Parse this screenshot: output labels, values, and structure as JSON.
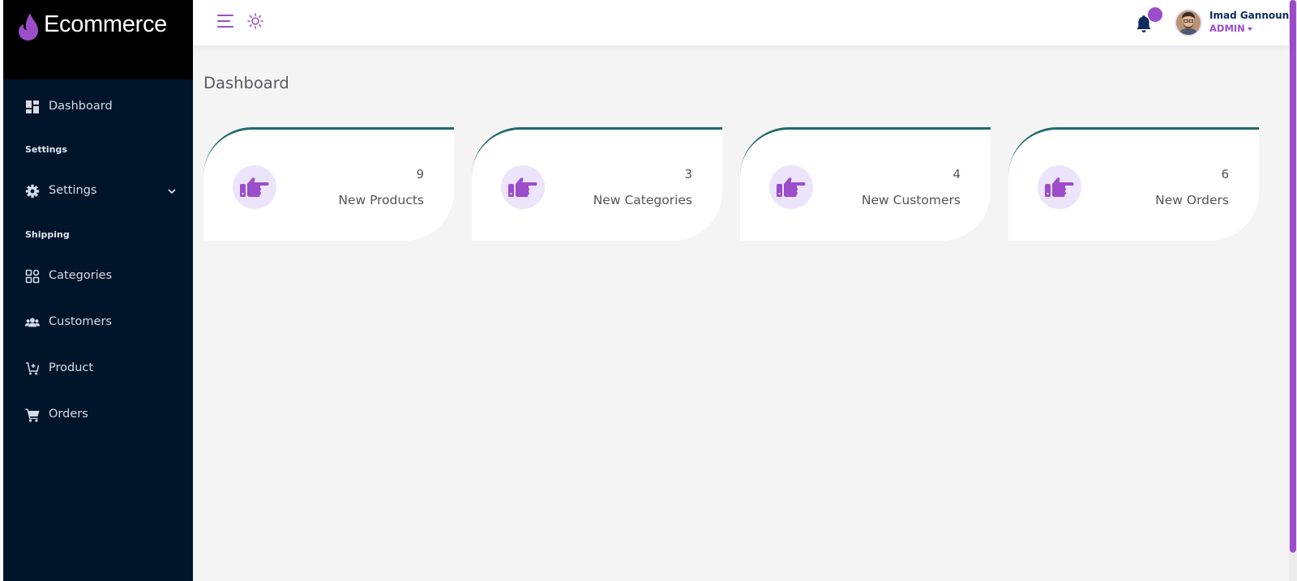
{
  "brand": {
    "name": "Ecommerce",
    "accent": "#9b4dca"
  },
  "sidebar": {
    "items": [
      {
        "label": "Dashboard",
        "icon": "dashboard-icon"
      },
      {
        "label": "Settings",
        "icon": "gear-icon"
      },
      {
        "label": "Categories",
        "icon": "grid-icon"
      },
      {
        "label": "Customers",
        "icon": "users-icon"
      },
      {
        "label": "Product",
        "icon": "cart-plus-icon"
      },
      {
        "label": "Orders",
        "icon": "shopping-cart-icon"
      }
    ],
    "sections": [
      "Settings",
      "Shipping"
    ]
  },
  "topbar": {
    "menu_icon": "hamburger-icon",
    "theme_icon": "sun-icon",
    "notification_icon": "bell-icon",
    "user": {
      "name": "Imad Gannoun",
      "role": "ADMIN"
    }
  },
  "main": {
    "title": "Dashboard",
    "cards": [
      {
        "value": "9",
        "label": "New Products",
        "icon": "hand-pointing-right-icon"
      },
      {
        "value": "3",
        "label": "New Categories",
        "icon": "hand-pointing-right-icon"
      },
      {
        "value": "4",
        "label": "New Customers",
        "icon": "hand-pointing-right-icon"
      },
      {
        "value": "6",
        "label": "New Orders",
        "icon": "hand-pointing-right-icon"
      }
    ]
  },
  "colors": {
    "sidebar": "#00142a",
    "brand_bg": "#000000",
    "card_border": "#1f6b6a",
    "icon_bg": "#ece4fa"
  }
}
